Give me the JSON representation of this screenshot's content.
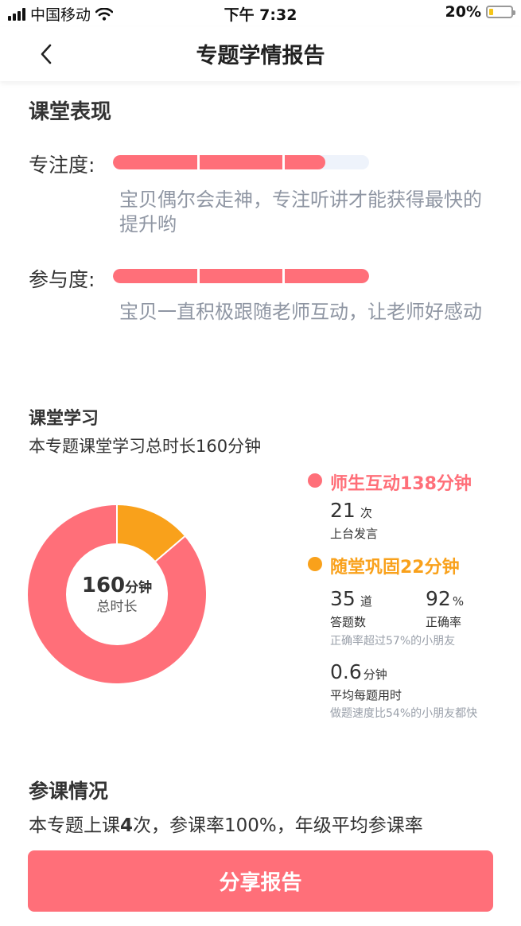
{
  "status_bar": {
    "carrier": "中国移动",
    "time": "下午 7:32",
    "battery": "20%",
    "battery_level": 0.2
  },
  "nav": {
    "title": "专题学情报告"
  },
  "performance": {
    "title": "课堂表现",
    "focus": {
      "label": "专注度:",
      "level": 0.83,
      "comment": "宝贝偶尔会走神，专注听讲才能获得最快的提升哟"
    },
    "participation": {
      "label": "参与度:",
      "level": 1.0,
      "comment": "宝贝一直积极跟随老师互动，让老师好感动"
    }
  },
  "learning": {
    "title": "课堂学习",
    "summary": "本专题课堂学习总时长160分钟",
    "donut": {
      "total_value": "160",
      "total_unit": "分钟",
      "total_label": "总时长"
    },
    "interaction": {
      "legend": "师生互动138分钟",
      "minutes": 138,
      "color": "#ff6f79",
      "count": "21",
      "count_unit": "次",
      "count_label": "上台发言"
    },
    "practice": {
      "legend": "随堂巩固22分钟",
      "minutes": 22,
      "color": "#f9a11b",
      "questions": "35",
      "questions_unit": "道",
      "questions_label": "答题数",
      "accuracy": "92",
      "accuracy_unit": "%",
      "accuracy_label": "正确率",
      "accuracy_note": "正确率超过57%的小朋友",
      "avg_time": "0.6",
      "avg_time_unit": "分钟",
      "avg_time_label": "平均每题用时",
      "speed_note": "做题速度比54%的小朋友都快"
    }
  },
  "attendance": {
    "title": "参课情况",
    "summary_prefix": "本专题上课",
    "summary_count": "4",
    "summary_suffix": "次，参课率100%，年级平均参课率"
  },
  "share_button": "分享报告"
}
